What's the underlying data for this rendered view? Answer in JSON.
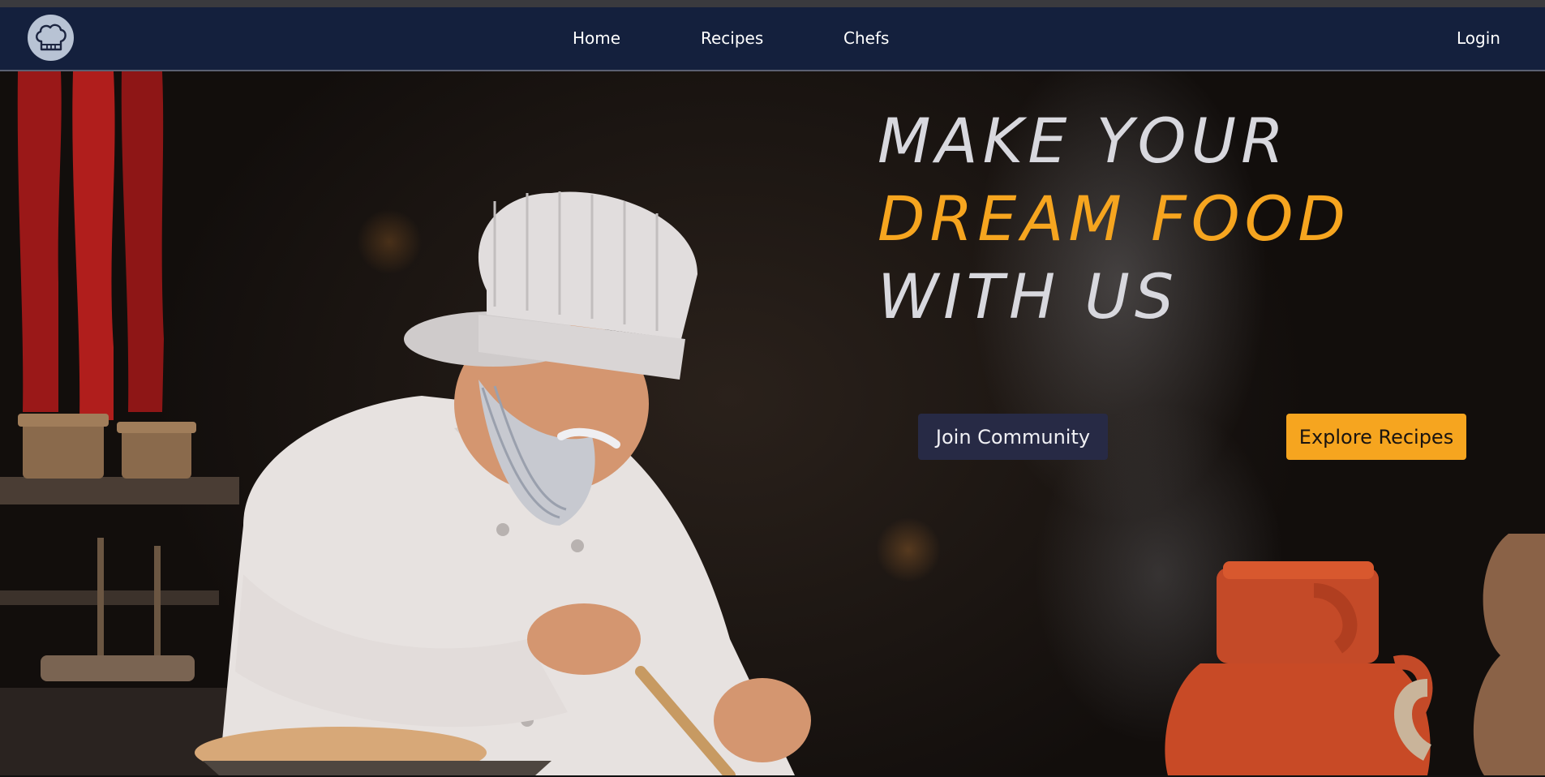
{
  "nav": {
    "logo_icon": "chef-hat-icon",
    "links": [
      "Home",
      "Recipes",
      "Chefs"
    ],
    "login": "Login"
  },
  "hero": {
    "line1": "MAKE YOUR",
    "line2": "DREAM FOOD",
    "line3": "WITH US",
    "join_label": "Join Community",
    "explore_label": "Explore Recipes"
  },
  "colors": {
    "navbar": "#14203d",
    "accent": "#f6a51f",
    "join_button": "#272a45"
  }
}
